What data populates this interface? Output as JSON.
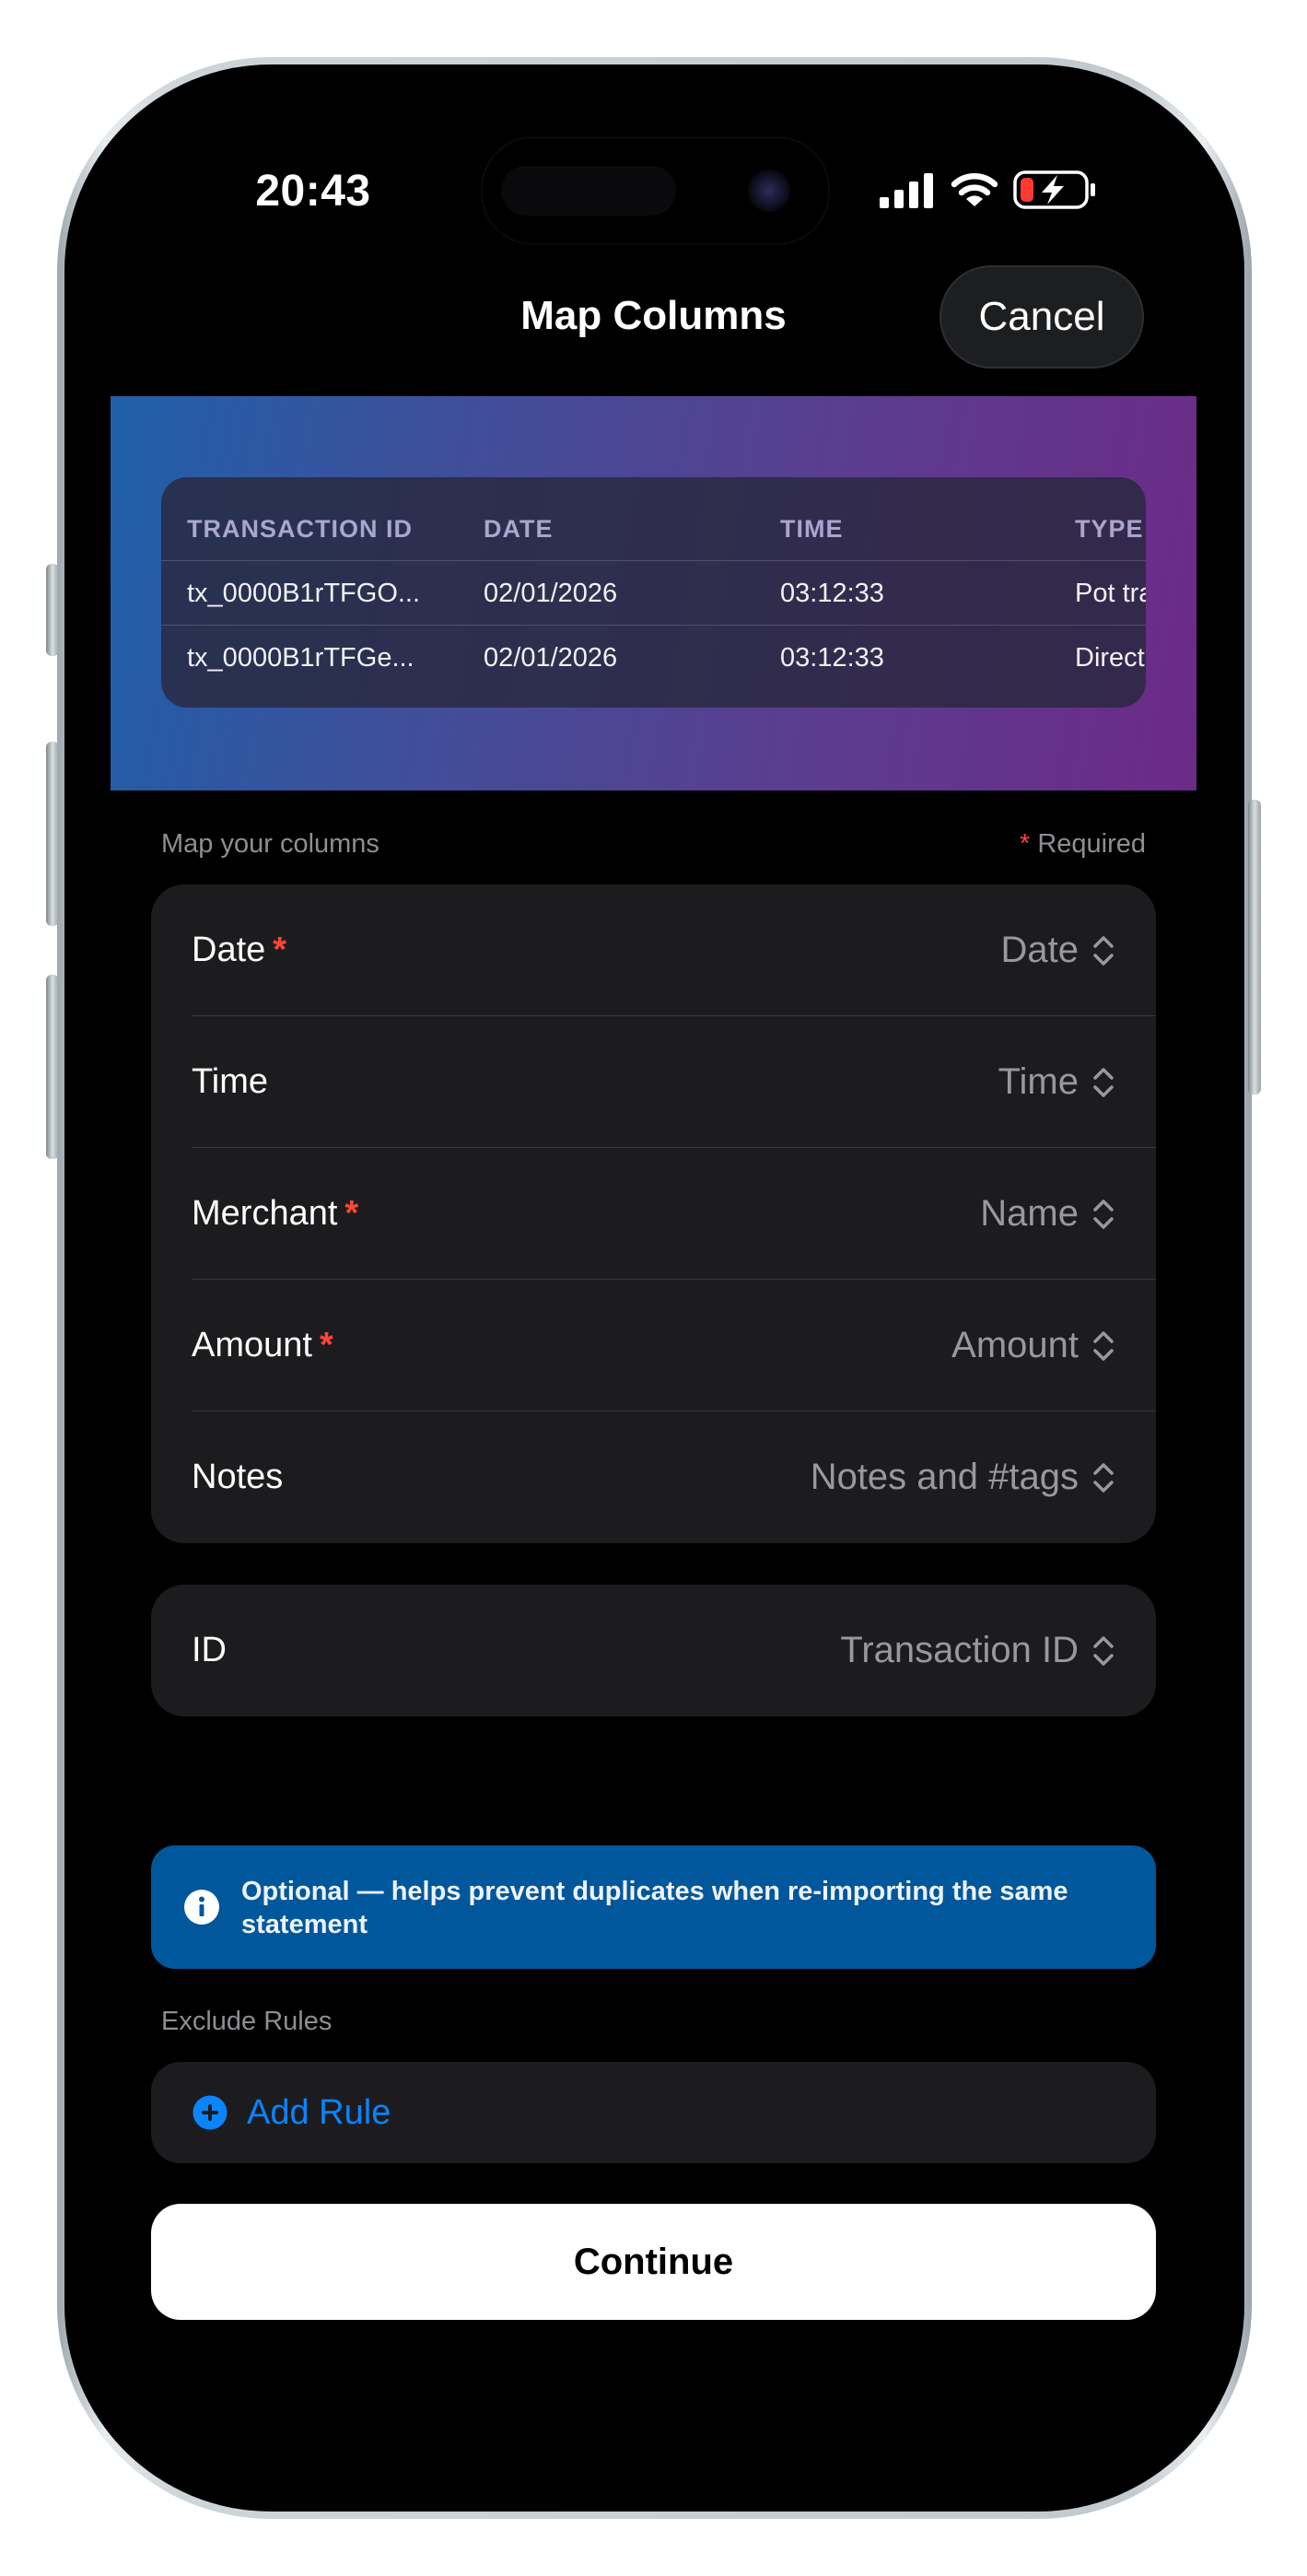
{
  "status_bar": {
    "time": "20:43"
  },
  "nav": {
    "title": "Map Columns",
    "cancel_label": "Cancel"
  },
  "preview": {
    "headers": [
      "TRANSACTION ID",
      "DATE",
      "TIME",
      "TYPE"
    ],
    "rows": [
      [
        "tx_0000B1rTFGO...",
        "02/01/2026",
        "03:12:33",
        "Pot tra"
      ],
      [
        "tx_0000B1rTFGe...",
        "02/01/2026",
        "03:12:33",
        "Direct"
      ]
    ]
  },
  "mapping": {
    "section_label": "Map your columns",
    "required_star": "*",
    "required_label": "Required",
    "rows": [
      {
        "label": "Date",
        "required": "*",
        "value": "Date"
      },
      {
        "label": "Time",
        "required": "",
        "value": "Time"
      },
      {
        "label": "Merchant",
        "required": "*",
        "value": "Name"
      },
      {
        "label": "Amount",
        "required": "*",
        "value": "Amount"
      },
      {
        "label": "Notes",
        "required": "",
        "value": "Notes and #tags"
      }
    ],
    "id_row": {
      "label": "ID",
      "value": "Transaction ID"
    }
  },
  "info_banner": {
    "text": "Optional — helps prevent duplicates when re-importing the same statement"
  },
  "exclude_rules": {
    "section_label": "Exclude Rules",
    "add_label": "Add Rule"
  },
  "continue_label": "Continue",
  "icons": {
    "signal": "cellular-signal-icon",
    "wifi": "wifi-icon",
    "battery": "battery-charging-icon",
    "chevron": "chevron-up-down-icon",
    "info": "info-circle-icon",
    "add": "plus-circle-icon"
  },
  "colors": {
    "accent_blue": "#0a84ff",
    "required_red": "#ff453a",
    "info_banner": "#00579c",
    "card_bg": "#1c1c1e"
  }
}
